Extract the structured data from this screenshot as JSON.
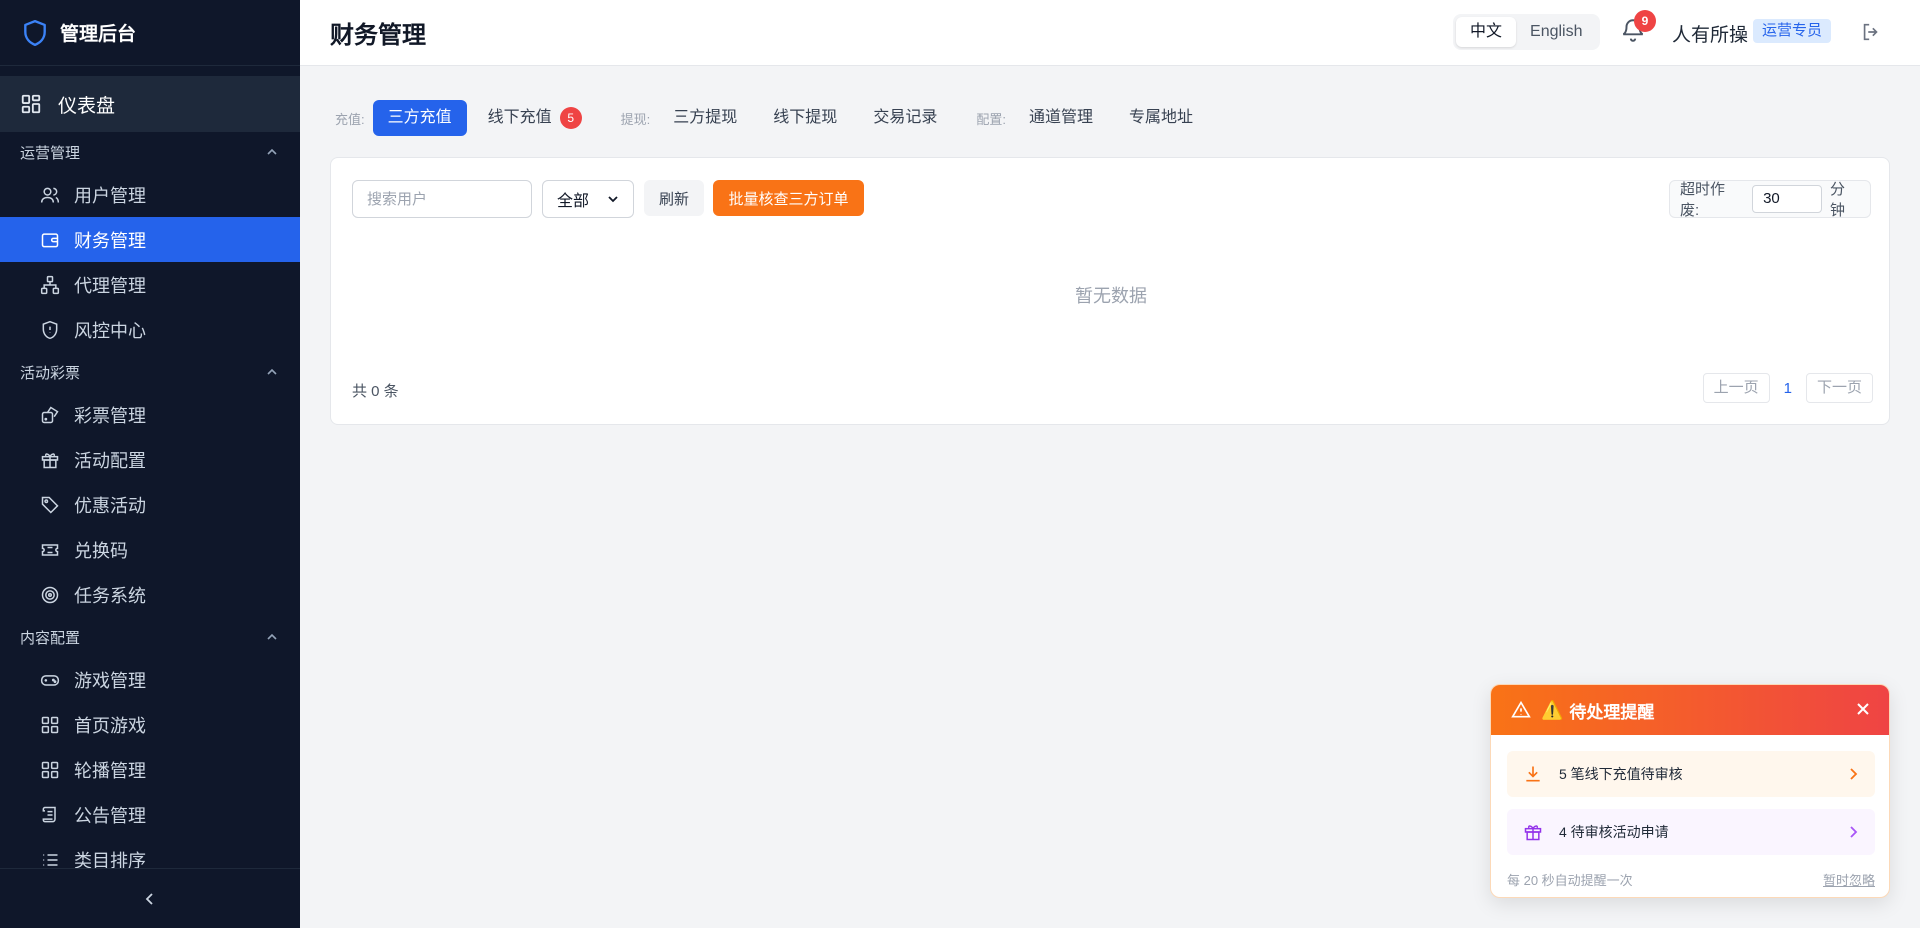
{
  "brand": {
    "title": "管理后台"
  },
  "sidebar": {
    "dashboard": "仪表盘",
    "groups": [
      {
        "title": "运营管理",
        "items": [
          "用户管理",
          "财务管理",
          "代理管理",
          "风控中心"
        ]
      },
      {
        "title": "活动彩票",
        "items": [
          "彩票管理",
          "活动配置",
          "优惠活动",
          "兑换码",
          "任务系统"
        ]
      },
      {
        "title": "内容配置",
        "items": [
          "游戏管理",
          "首页游戏",
          "轮播管理",
          "公告管理",
          "类目排序"
        ]
      }
    ],
    "active": "财务管理"
  },
  "header": {
    "title": "财务管理",
    "lang_zh": "中文",
    "lang_en": "English",
    "notif_count": "9",
    "user": "人有所操",
    "role": "运营专员"
  },
  "tabs": {
    "recharge_label": "充值:",
    "third_recharge": "三方充值",
    "offline_recharge": "线下充值",
    "offline_recharge_count": "5",
    "withdraw_label": "提现:",
    "third_withdraw": "三方提现",
    "offline_withdraw": "线下提现",
    "transactions": "交易记录",
    "config_label": "配置:",
    "channels": "通道管理",
    "exclusive_address": "专属地址"
  },
  "toolbar": {
    "search_placeholder": "搜索用户",
    "filter_value": "全部",
    "refresh": "刷新",
    "batch_check": "批量核查三方订单",
    "timeout_label": "超时作废:",
    "timeout_value": "30",
    "timeout_unit": "分钟"
  },
  "table": {
    "empty": "暂无数据",
    "total": "共 0 条",
    "prev": "上一页",
    "page": "1",
    "next": "下一页"
  },
  "notify": {
    "title": "待处理提醒",
    "emoji": "⚠️",
    "row1": "5 笔线下充值待审核",
    "row2": "4 待审核活动申请",
    "footer": "每 20 秒自动提醒一次",
    "dismiss": "暂时忽略"
  },
  "colors": {
    "primary": "#2563eb",
    "sidebar": "#0f172a",
    "accent": "#f97316",
    "danger": "#ef4444"
  }
}
